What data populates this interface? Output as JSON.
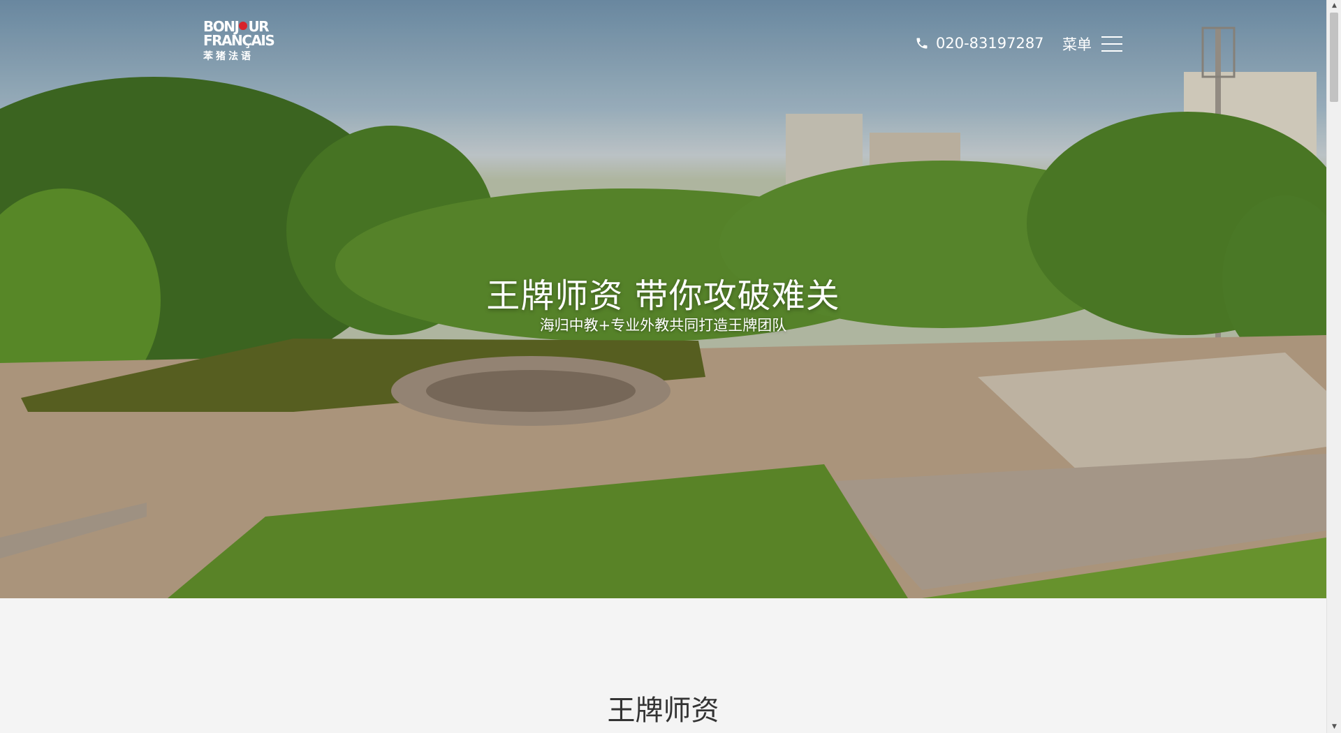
{
  "header": {
    "logo": {
      "line1a": "BONJ",
      "line1b": "UR",
      "line2": "FRANÇAIS",
      "line3": "苯猪法语"
    },
    "phone": "020-83197287",
    "menu_label": "菜单"
  },
  "hero": {
    "title": "王牌师资 带你攻破难关",
    "subtitle": "海归中教+专业外教共同打造王牌团队"
  },
  "section": {
    "title": "王牌师资"
  },
  "colors": {
    "accent": "#d8232a",
    "background": "#f4f4f4",
    "text": "#333333"
  },
  "icons": {
    "phone": "phone-icon",
    "menu": "hamburger-menu-icon",
    "scroll_up": "scroll-up-arrow-icon",
    "scroll_down": "scroll-down-arrow-icon"
  }
}
